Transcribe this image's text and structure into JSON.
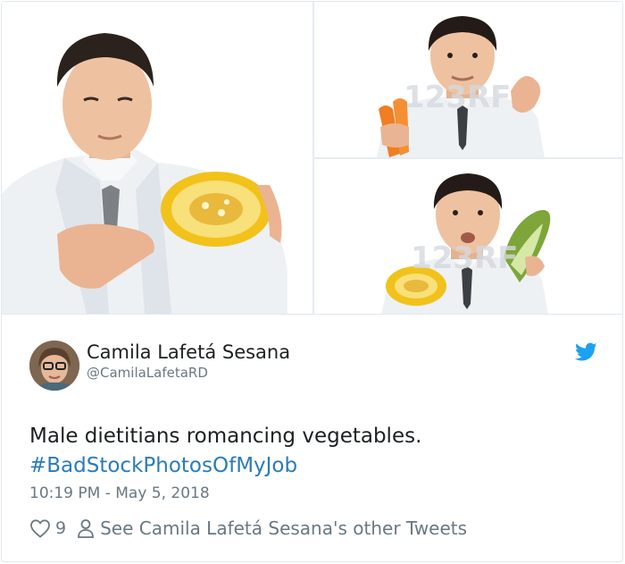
{
  "media": {
    "watermark": "123RF",
    "photos": [
      {
        "subject": "man-with-pumpkin"
      },
      {
        "subject": "man-with-carrots"
      },
      {
        "subject": "man-with-pumpkin-and-bokchoy"
      }
    ]
  },
  "tweet": {
    "author_name": "Camila Lafetá Sesana",
    "author_handle": "@CamilaLafetaRD",
    "text": "Male dietitians romancing vegetables.",
    "hashtag": "#BadStockPhotosOfMyJob",
    "timestamp": "10:19 PM - May 5, 2018",
    "like_count": "9",
    "other_tweets_label": "See Camila Lafetá Sesana's other Tweets"
  },
  "colors": {
    "link": "#2b7bb9",
    "muted": "#697882",
    "twitter_blue": "#1da1f2",
    "border": "#e1e8ed"
  },
  "icons": [
    "twitter-bird-icon",
    "heart-icon",
    "person-icon"
  ]
}
